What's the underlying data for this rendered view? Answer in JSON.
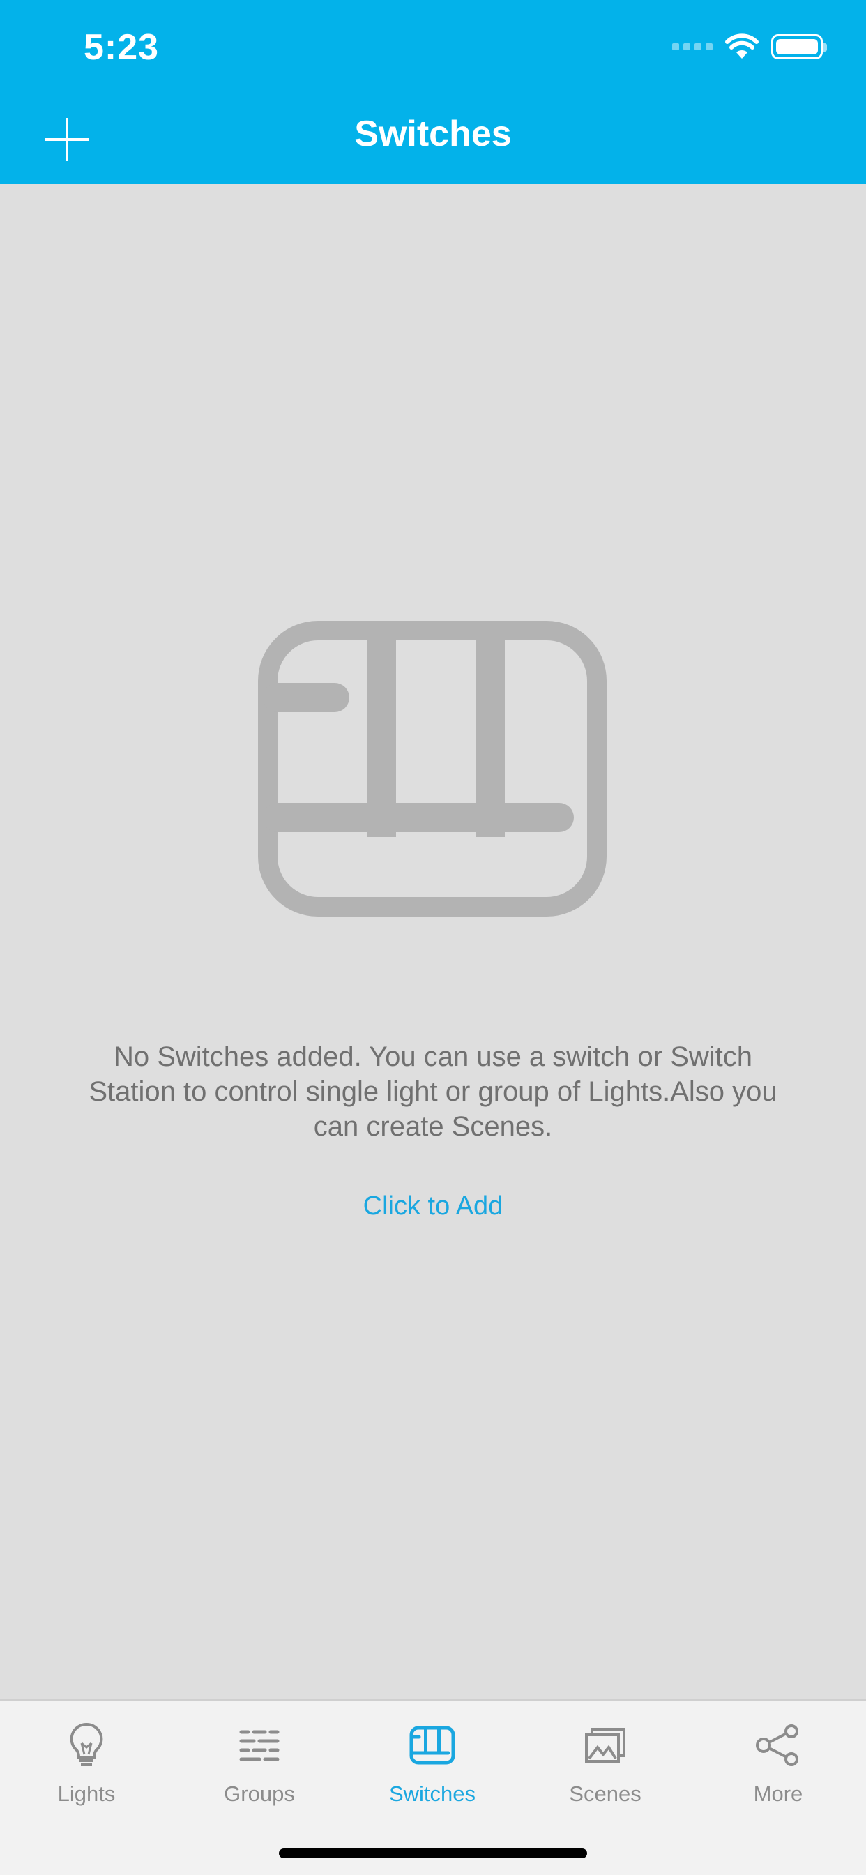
{
  "status_bar": {
    "time": "5:23"
  },
  "header": {
    "title": "Switches"
  },
  "empty_state": {
    "message": "No Switches added. You can use a switch or Switch Station to control single light or group of Lights.Also you can create Scenes.",
    "action_label": "Click to Add"
  },
  "tabbar": {
    "tabs": [
      {
        "label": "Lights",
        "icon": "bulb-icon"
      },
      {
        "label": "Groups",
        "icon": "groups-icon"
      },
      {
        "label": "Switches",
        "icon": "switch-icon"
      },
      {
        "label": "Scenes",
        "icon": "scenes-icon"
      },
      {
        "label": "More",
        "icon": "share-icon"
      }
    ],
    "active": "Switches"
  },
  "colors": {
    "accent": "#03b2ea",
    "background": "#dedede",
    "icon_placeholder": "#b3b3b3",
    "tab_inactive": "#8c8c8c",
    "tab_active": "#1aa7e0"
  }
}
